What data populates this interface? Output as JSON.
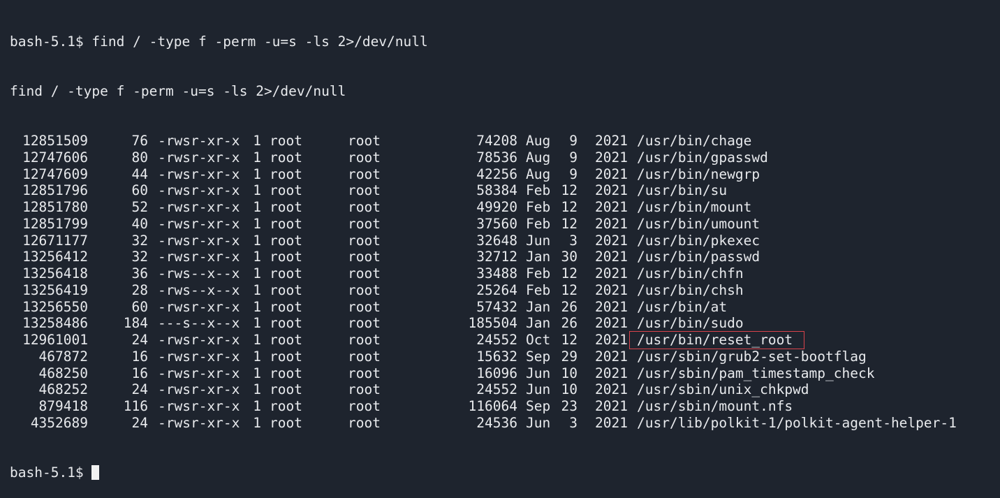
{
  "terminal": {
    "prompt": "bash-5.1$ ",
    "command": "find / -type f -perm -u=s -ls 2>/dev/null",
    "echo": "find / -type f -perm -u=s -ls 2>/dev/null",
    "rows": [
      {
        "inode": "12851509",
        "blocks": "76",
        "perm": "-rwsr-xr-x",
        "links": "1",
        "owner": "root",
        "group": "root",
        "size": "74208",
        "month": "Aug",
        "day": "9",
        "year": "2021",
        "path": "/usr/bin/chage"
      },
      {
        "inode": "12747606",
        "blocks": "80",
        "perm": "-rwsr-xr-x",
        "links": "1",
        "owner": "root",
        "group": "root",
        "size": "78536",
        "month": "Aug",
        "day": "9",
        "year": "2021",
        "path": "/usr/bin/gpasswd"
      },
      {
        "inode": "12747609",
        "blocks": "44",
        "perm": "-rwsr-xr-x",
        "links": "1",
        "owner": "root",
        "group": "root",
        "size": "42256",
        "month": "Aug",
        "day": "9",
        "year": "2021",
        "path": "/usr/bin/newgrp"
      },
      {
        "inode": "12851796",
        "blocks": "60",
        "perm": "-rwsr-xr-x",
        "links": "1",
        "owner": "root",
        "group": "root",
        "size": "58384",
        "month": "Feb",
        "day": "12",
        "year": "2021",
        "path": "/usr/bin/su"
      },
      {
        "inode": "12851780",
        "blocks": "52",
        "perm": "-rwsr-xr-x",
        "links": "1",
        "owner": "root",
        "group": "root",
        "size": "49920",
        "month": "Feb",
        "day": "12",
        "year": "2021",
        "path": "/usr/bin/mount"
      },
      {
        "inode": "12851799",
        "blocks": "40",
        "perm": "-rwsr-xr-x",
        "links": "1",
        "owner": "root",
        "group": "root",
        "size": "37560",
        "month": "Feb",
        "day": "12",
        "year": "2021",
        "path": "/usr/bin/umount"
      },
      {
        "inode": "12671177",
        "blocks": "32",
        "perm": "-rwsr-xr-x",
        "links": "1",
        "owner": "root",
        "group": "root",
        "size": "32648",
        "month": "Jun",
        "day": "3",
        "year": "2021",
        "path": "/usr/bin/pkexec"
      },
      {
        "inode": "13256412",
        "blocks": "32",
        "perm": "-rwsr-xr-x",
        "links": "1",
        "owner": "root",
        "group": "root",
        "size": "32712",
        "month": "Jan",
        "day": "30",
        "year": "2021",
        "path": "/usr/bin/passwd"
      },
      {
        "inode": "13256418",
        "blocks": "36",
        "perm": "-rws--x--x",
        "links": "1",
        "owner": "root",
        "group": "root",
        "size": "33488",
        "month": "Feb",
        "day": "12",
        "year": "2021",
        "path": "/usr/bin/chfn"
      },
      {
        "inode": "13256419",
        "blocks": "28",
        "perm": "-rws--x--x",
        "links": "1",
        "owner": "root",
        "group": "root",
        "size": "25264",
        "month": "Feb",
        "day": "12",
        "year": "2021",
        "path": "/usr/bin/chsh"
      },
      {
        "inode": "13256550",
        "blocks": "60",
        "perm": "-rwsr-xr-x",
        "links": "1",
        "owner": "root",
        "group": "root",
        "size": "57432",
        "month": "Jan",
        "day": "26",
        "year": "2021",
        "path": "/usr/bin/at"
      },
      {
        "inode": "13258486",
        "blocks": "184",
        "perm": "---s--x--x",
        "links": "1",
        "owner": "root",
        "group": "root",
        "size": "185504",
        "month": "Jan",
        "day": "26",
        "year": "2021",
        "path": "/usr/bin/sudo"
      },
      {
        "inode": "12961001",
        "blocks": "24",
        "perm": "-rwsr-xr-x",
        "links": "1",
        "owner": "root",
        "group": "root",
        "size": "24552",
        "month": "Oct",
        "day": "12",
        "year": "2021",
        "path": "/usr/bin/reset_root",
        "highlight": true
      },
      {
        "inode": "467872",
        "blocks": "16",
        "perm": "-rwsr-xr-x",
        "links": "1",
        "owner": "root",
        "group": "root",
        "size": "15632",
        "month": "Sep",
        "day": "29",
        "year": "2021",
        "path": "/usr/sbin/grub2-set-bootflag"
      },
      {
        "inode": "468250",
        "blocks": "16",
        "perm": "-rwsr-xr-x",
        "links": "1",
        "owner": "root",
        "group": "root",
        "size": "16096",
        "month": "Jun",
        "day": "10",
        "year": "2021",
        "path": "/usr/sbin/pam_timestamp_check"
      },
      {
        "inode": "468252",
        "blocks": "24",
        "perm": "-rwsr-xr-x",
        "links": "1",
        "owner": "root",
        "group": "root",
        "size": "24552",
        "month": "Jun",
        "day": "10",
        "year": "2021",
        "path": "/usr/sbin/unix_chkpwd"
      },
      {
        "inode": "879418",
        "blocks": "116",
        "perm": "-rwsr-xr-x",
        "links": "1",
        "owner": "root",
        "group": "root",
        "size": "116064",
        "month": "Sep",
        "day": "23",
        "year": "2021",
        "path": "/usr/sbin/mount.nfs"
      },
      {
        "inode": "4352689",
        "blocks": "24",
        "perm": "-rwsr-xr-x",
        "links": "1",
        "owner": "root",
        "group": "root",
        "size": "24536",
        "month": "Jun",
        "day": "3",
        "year": "2021",
        "path": "/usr/lib/polkit-1/polkit-agent-helper-1"
      }
    ],
    "final_prompt": "bash-5.1$ ",
    "colors": {
      "background": "#1e242e",
      "foreground": "#e8eaed",
      "highlight_box": "#d9434b",
      "cursor": "#f2f2f2"
    }
  }
}
